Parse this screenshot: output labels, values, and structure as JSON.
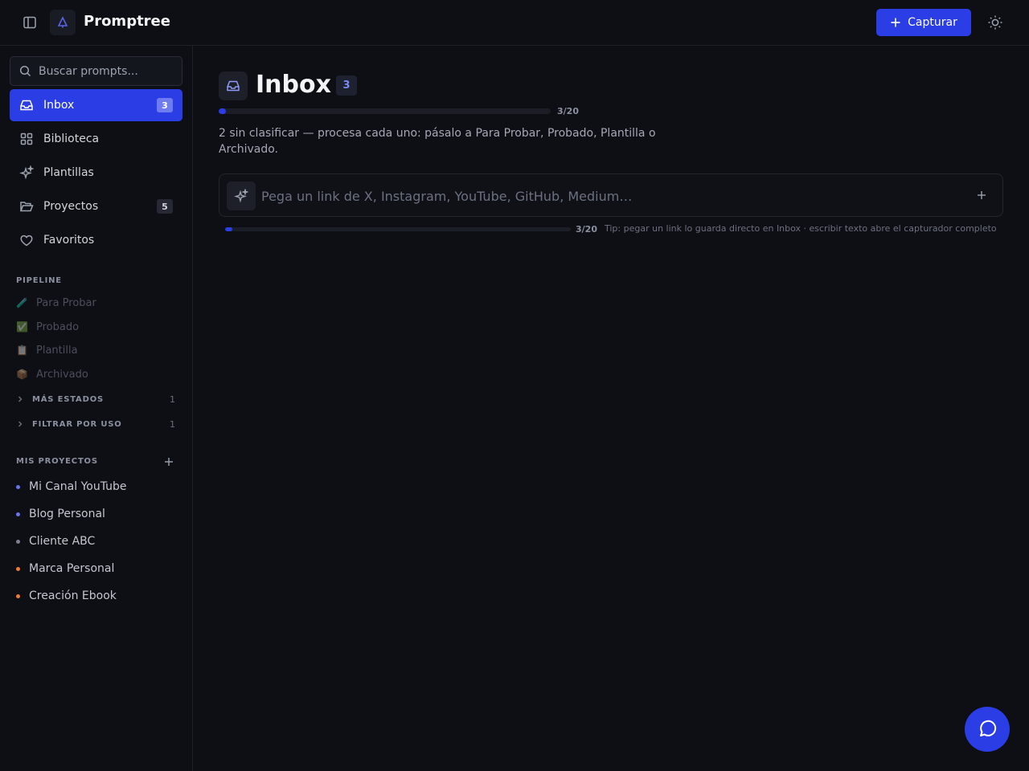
{
  "header": {
    "app_title": "Promptree",
    "capture_label": "Capturar"
  },
  "sidebar": {
    "search": {
      "placeholder": "Buscar prompts..."
    },
    "nav": [
      {
        "label": "Inbox",
        "badge": "3",
        "icon": "inbox-icon",
        "active": true
      },
      {
        "label": "Biblioteca",
        "icon": "grid-icon"
      },
      {
        "label": "Plantillas",
        "icon": "sparkles-icon"
      },
      {
        "label": "Proyectos",
        "badge": "5",
        "icon": "folder-open-icon"
      },
      {
        "label": "Favoritos",
        "icon": "heart-icon"
      }
    ],
    "pipeline_title": "PIPELINE",
    "pipeline": [
      {
        "emoji": "🧪",
        "label": "Para Probar"
      },
      {
        "emoji": "✅",
        "label": "Probado"
      },
      {
        "emoji": "📋",
        "label": "Plantilla"
      },
      {
        "emoji": "📦",
        "label": "Archivado"
      }
    ],
    "more_states": {
      "label": "MÁS ESTADOS",
      "count": "1"
    },
    "filter_by_use": {
      "label": "FILTRAR POR USO",
      "count": "1"
    },
    "projects_title": "MIS PROYECTOS",
    "projects": [
      {
        "label": "Mi Canal YouTube",
        "color": "#6b74f0"
      },
      {
        "label": "Blog Personal",
        "color": "#6b74f0"
      },
      {
        "label": "Cliente ABC",
        "color": "#7c8090"
      },
      {
        "label": "Marca Personal",
        "color": "#f07a3a"
      },
      {
        "label": "Creación Ebook",
        "color": "#f07a3a"
      }
    ]
  },
  "main": {
    "title": "Inbox",
    "count_badge": "3",
    "progress": {
      "label": "3/20",
      "value": 3,
      "max": 20
    },
    "description": "2 sin clasificar — procesa cada uno: pásalo a Para Probar, Probado, Plantilla o Archivado.",
    "link_input": {
      "placeholder": "Pega un link de X, Instagram, YouTube, GitHub, Medium…"
    },
    "bottom_progress": {
      "label": "3/20",
      "value": 3,
      "max": 20
    },
    "tip": "Tip: pegar un link lo guarda directo en Inbox · escribir texto abre el capturador completo"
  },
  "colors": {
    "accent": "#2b3ee6",
    "background": "#0e0f14"
  }
}
